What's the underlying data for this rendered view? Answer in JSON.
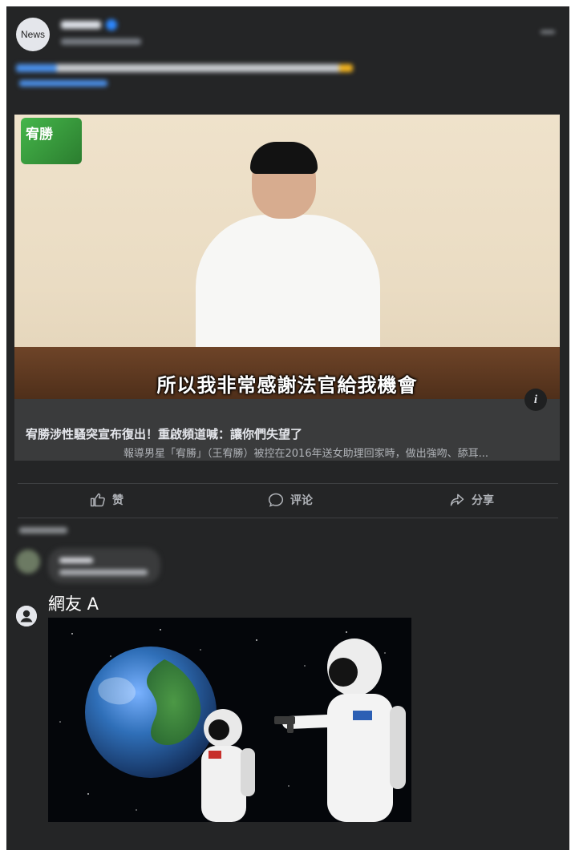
{
  "page": {
    "avatar_label": "News",
    "video_caption": "所以我非常感謝法官給我機會",
    "badge_label": "宥勝",
    "card_title": "宥勝涉性騷突宣布復出！重啟頻道喊：讓你們失望了",
    "card_description": "報導男星「宥勝」（王宥勝）被控在2016年送女助理回家時，做出強吻、舔耳...",
    "actions": {
      "like": "赞",
      "comment": "评论",
      "share": "分享"
    },
    "commenter_label": "網友 A",
    "info_icon": "i"
  }
}
